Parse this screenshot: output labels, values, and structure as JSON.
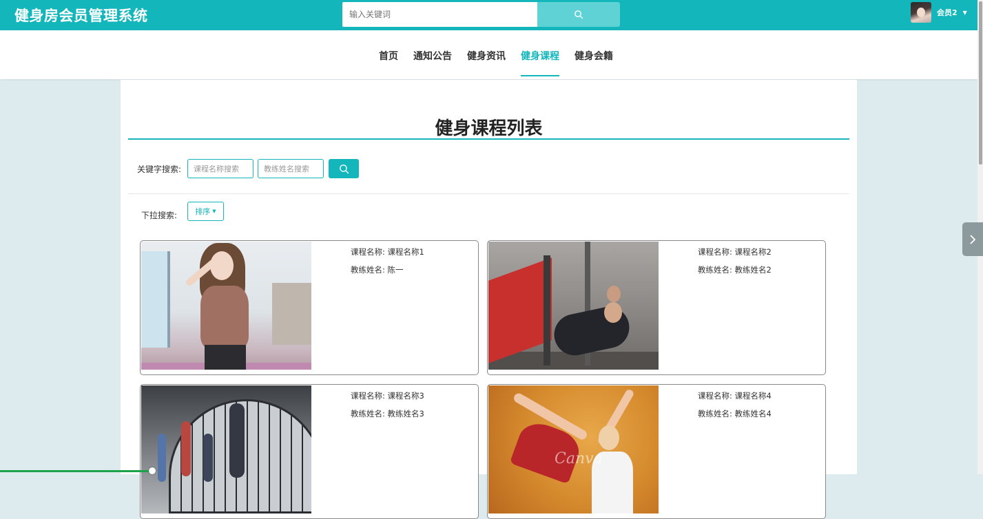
{
  "header": {
    "title": "健身房会员管理系统",
    "search_placeholder": "输入关键词",
    "user_name": "会员2"
  },
  "nav": {
    "items": [
      {
        "label": "首页",
        "active": false
      },
      {
        "label": "通知公告",
        "active": false
      },
      {
        "label": "健身资讯",
        "active": false
      },
      {
        "label": "健身课程",
        "active": true
      },
      {
        "label": "健身会籍",
        "active": false
      }
    ]
  },
  "page": {
    "title": "健身课程列表",
    "keyword_label": "关键字搜索:",
    "course_placeholder": "课程名称搜索",
    "coach_placeholder": "教练姓名搜索",
    "dropdown_label": "下拉搜索:",
    "sort_label": "排序"
  },
  "cards": [
    {
      "course_label": "课程名称:",
      "course": "课程名称1",
      "coach_label": "教练姓名:",
      "coach": "陈一"
    },
    {
      "course_label": "课程名称:",
      "course": "课程名称2",
      "coach_label": "教练姓名:",
      "coach": "教练姓名2"
    },
    {
      "course_label": "课程名称:",
      "course": "课程名称3",
      "coach_label": "教练姓名:",
      "coach": "教练姓名3"
    },
    {
      "course_label": "课程名称:",
      "course": "课程名称4",
      "coach_label": "教练姓名:",
      "coach": "教练姓名4"
    }
  ],
  "theme": {
    "accent": "#12b6bb",
    "page_background": "#deebee"
  },
  "icons": {
    "search": "search-icon",
    "caret": "caret-down-icon",
    "side_next": "chevron-right-icon"
  },
  "video_progress": 0.155
}
